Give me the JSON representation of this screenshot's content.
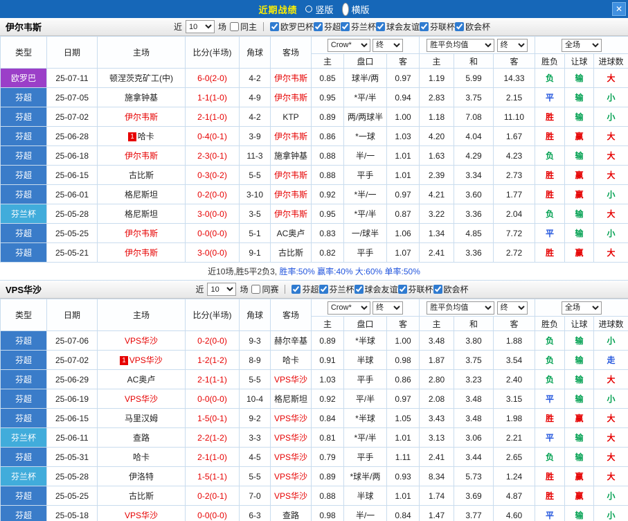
{
  "topbar": {
    "title": "近期战绩",
    "radios": [
      {
        "label": "竖版",
        "selected": false
      },
      {
        "label": "横版",
        "selected": true
      }
    ],
    "close_glyph": "✕"
  },
  "table_header": {
    "cols": [
      "类型",
      "日期",
      "主场",
      "比分(半场)",
      "角球",
      "客场"
    ],
    "odds_bookmaker": "Crow*",
    "odds_period": "终",
    "avg_label": "胜平负均值",
    "avg_period": "终",
    "scope_label": "全场",
    "sub_cols": [
      "主",
      "盘口",
      "客",
      "主",
      "和",
      "客",
      "胜负",
      "让球",
      "进球数"
    ]
  },
  "league_colors": {
    "欧罗巴": "#9B3FC8",
    "芬超": "#3A7CC9",
    "芬兰杯": "#41ACDB"
  },
  "result_colors": {
    "red": "#E60000",
    "green": "#00A050",
    "blue": "#2255DD",
    "black": "#333333"
  },
  "sections": [
    {
      "team": "伊尔韦斯",
      "filters": {
        "recent_pre": "近",
        "recent_value": "10",
        "recent_post": "场",
        "same_label": "同主",
        "same_checked": false,
        "leagues": [
          {
            "label": "欧罗巴杯",
            "checked": true
          },
          {
            "label": "芬超",
            "checked": true
          },
          {
            "label": "芬兰杯",
            "checked": true
          },
          {
            "label": "球会友谊",
            "checked": true
          },
          {
            "label": "芬联杯",
            "checked": true
          },
          {
            "label": "欧会杯",
            "checked": true
          }
        ]
      },
      "rows": [
        {
          "league": "欧罗巴",
          "date": "25-07-11",
          "home": "顿涅茨克矿工(中)",
          "home_red": false,
          "badge": "",
          "score": "6-0(2-0)",
          "corner": "4-2",
          "away": "伊尔韦斯",
          "away_red": true,
          "oh": "0.85",
          "hcp": "球半/两",
          "oa": "0.97",
          "ah": "1.19",
          "ad": "5.99",
          "aa": "14.33",
          "r1": "负",
          "c1": "green",
          "r2": "输",
          "c2": "green",
          "r3": "大",
          "c3": "red"
        },
        {
          "league": "芬超",
          "date": "25-07-05",
          "home": "施拿钟基",
          "home_red": false,
          "badge": "",
          "score": "1-1(1-0)",
          "corner": "4-9",
          "away": "伊尔韦斯",
          "away_red": true,
          "oh": "0.95",
          "hcp": "*平/半",
          "oa": "0.94",
          "ah": "2.83",
          "ad": "3.75",
          "aa": "2.15",
          "r1": "平",
          "c1": "blue",
          "r2": "输",
          "c2": "green",
          "r3": "小",
          "c3": "green"
        },
        {
          "league": "芬超",
          "date": "25-07-02",
          "home": "伊尔韦斯",
          "home_red": true,
          "badge": "",
          "score": "2-1(1-0)",
          "corner": "4-2",
          "away": "KTP",
          "away_red": false,
          "oh": "0.89",
          "hcp": "两/两球半",
          "oa": "1.00",
          "ah": "1.18",
          "ad": "7.08",
          "aa": "11.10",
          "r1": "胜",
          "c1": "red",
          "r2": "输",
          "c2": "green",
          "r3": "小",
          "c3": "green"
        },
        {
          "league": "芬超",
          "date": "25-06-28",
          "home": "哈卡",
          "home_red": false,
          "badge": "1",
          "score": "0-4(0-1)",
          "corner": "3-9",
          "away": "伊尔韦斯",
          "away_red": true,
          "oh": "0.86",
          "hcp": "*一球",
          "oa": "1.03",
          "ah": "4.20",
          "ad": "4.04",
          "aa": "1.67",
          "r1": "胜",
          "c1": "red",
          "r2": "赢",
          "c2": "red",
          "r3": "大",
          "c3": "red"
        },
        {
          "league": "芬超",
          "date": "25-06-18",
          "home": "伊尔韦斯",
          "home_red": true,
          "badge": "",
          "score": "2-3(0-1)",
          "corner": "11-3",
          "away": "施拿钟基",
          "away_red": false,
          "oh": "0.88",
          "hcp": "半/一",
          "oa": "1.01",
          "ah": "1.63",
          "ad": "4.29",
          "aa": "4.23",
          "r1": "负",
          "c1": "green",
          "r2": "输",
          "c2": "green",
          "r3": "大",
          "c3": "red"
        },
        {
          "league": "芬超",
          "date": "25-06-15",
          "home": "古比斯",
          "home_red": false,
          "badge": "",
          "score": "0-3(0-2)",
          "corner": "5-5",
          "away": "伊尔韦斯",
          "away_red": true,
          "oh": "0.88",
          "hcp": "平手",
          "oa": "1.01",
          "ah": "2.39",
          "ad": "3.34",
          "aa": "2.73",
          "r1": "胜",
          "c1": "red",
          "r2": "赢",
          "c2": "red",
          "r3": "大",
          "c3": "red"
        },
        {
          "league": "芬超",
          "date": "25-06-01",
          "home": "格尼斯坦",
          "home_red": false,
          "badge": "",
          "score": "0-2(0-0)",
          "corner": "3-10",
          "away": "伊尔韦斯",
          "away_red": true,
          "oh": "0.92",
          "hcp": "*半/一",
          "oa": "0.97",
          "ah": "4.21",
          "ad": "3.60",
          "aa": "1.77",
          "r1": "胜",
          "c1": "red",
          "r2": "赢",
          "c2": "red",
          "r3": "小",
          "c3": "green"
        },
        {
          "league": "芬兰杯",
          "date": "25-05-28",
          "home": "格尼斯坦",
          "home_red": false,
          "badge": "",
          "score": "3-0(0-0)",
          "corner": "3-5",
          "away": "伊尔韦斯",
          "away_red": true,
          "oh": "0.95",
          "hcp": "*平/半",
          "oa": "0.87",
          "ah": "3.22",
          "ad": "3.36",
          "aa": "2.04",
          "r1": "负",
          "c1": "green",
          "r2": "输",
          "c2": "green",
          "r3": "大",
          "c3": "red"
        },
        {
          "league": "芬超",
          "date": "25-05-25",
          "home": "伊尔韦斯",
          "home_red": true,
          "badge": "",
          "score": "0-0(0-0)",
          "corner": "5-1",
          "away": "AC奥卢",
          "away_red": false,
          "oh": "0.83",
          "hcp": "一/球半",
          "oa": "1.06",
          "ah": "1.34",
          "ad": "4.85",
          "aa": "7.72",
          "r1": "平",
          "c1": "blue",
          "r2": "输",
          "c2": "green",
          "r3": "小",
          "c3": "green"
        },
        {
          "league": "芬超",
          "date": "25-05-21",
          "home": "伊尔韦斯",
          "home_red": true,
          "badge": "",
          "score": "3-0(0-0)",
          "corner": "9-1",
          "away": "古比斯",
          "away_red": false,
          "oh": "0.82",
          "hcp": "平手",
          "oa": "1.07",
          "ah": "2.41",
          "ad": "3.36",
          "aa": "2.72",
          "r1": "胜",
          "c1": "red",
          "r2": "赢",
          "c2": "red",
          "r3": "大",
          "c3": "red"
        }
      ],
      "summary": [
        {
          "text": "近10场,胜5平2负3, ",
          "color": "#333333"
        },
        {
          "text": "胜率:50% ",
          "color": "#2255DD"
        },
        {
          "text": "赢率:40% ",
          "color": "#2255DD"
        },
        {
          "text": "大:60% ",
          "color": "#2255DD"
        },
        {
          "text": "单率:50%",
          "color": "#2255DD"
        }
      ]
    },
    {
      "team": "VPS华沙",
      "filters": {
        "recent_pre": "近",
        "recent_value": "10",
        "recent_post": "场",
        "same_label": "同赛",
        "same_checked": false,
        "leagues": [
          {
            "label": "芬超",
            "checked": true
          },
          {
            "label": "芬兰杯",
            "checked": true
          },
          {
            "label": "球会友谊",
            "checked": true
          },
          {
            "label": "芬联杯",
            "checked": true
          },
          {
            "label": "欧会杯",
            "checked": true
          }
        ]
      },
      "rows": [
        {
          "league": "芬超",
          "date": "25-07-06",
          "home": "VPS华沙",
          "home_red": true,
          "badge": "",
          "score": "0-2(0-0)",
          "corner": "9-3",
          "away": "赫尔辛基",
          "away_red": false,
          "oh": "0.89",
          "hcp": "*半球",
          "oa": "1.00",
          "ah": "3.48",
          "ad": "3.80",
          "aa": "1.88",
          "r1": "负",
          "c1": "green",
          "r2": "输",
          "c2": "green",
          "r3": "小",
          "c3": "green"
        },
        {
          "league": "芬超",
          "date": "25-07-02",
          "home": "VPS华沙",
          "home_red": true,
          "badge": "1",
          "score": "1-2(1-2)",
          "corner": "8-9",
          "away": "哈卡",
          "away_red": false,
          "oh": "0.91",
          "hcp": "半球",
          "oa": "0.98",
          "ah": "1.87",
          "ad": "3.75",
          "aa": "3.54",
          "r1": "负",
          "c1": "green",
          "r2": "输",
          "c2": "green",
          "r3": "走",
          "c3": "blue"
        },
        {
          "league": "芬超",
          "date": "25-06-29",
          "home": "AC奥卢",
          "home_red": false,
          "badge": "",
          "score": "2-1(1-1)",
          "corner": "5-5",
          "away": "VPS华沙",
          "away_red": true,
          "oh": "1.03",
          "hcp": "平手",
          "oa": "0.86",
          "ah": "2.80",
          "ad": "3.23",
          "aa": "2.40",
          "r1": "负",
          "c1": "green",
          "r2": "输",
          "c2": "green",
          "r3": "大",
          "c3": "red"
        },
        {
          "league": "芬超",
          "date": "25-06-19",
          "home": "VPS华沙",
          "home_red": true,
          "badge": "",
          "score": "0-0(0-0)",
          "corner": "10-4",
          "away": "格尼斯坦",
          "away_red": false,
          "oh": "0.92",
          "hcp": "平/半",
          "oa": "0.97",
          "ah": "2.08",
          "ad": "3.48",
          "aa": "3.15",
          "r1": "平",
          "c1": "blue",
          "r2": "输",
          "c2": "green",
          "r3": "小",
          "c3": "green"
        },
        {
          "league": "芬超",
          "date": "25-06-15",
          "home": "马里汉姆",
          "home_red": false,
          "badge": "",
          "score": "1-5(0-1)",
          "corner": "9-2",
          "away": "VPS华沙",
          "away_red": true,
          "oh": "0.84",
          "hcp": "*半球",
          "oa": "1.05",
          "ah": "3.43",
          "ad": "3.48",
          "aa": "1.98",
          "r1": "胜",
          "c1": "red",
          "r2": "赢",
          "c2": "red",
          "r3": "大",
          "c3": "red"
        },
        {
          "league": "芬兰杯",
          "date": "25-06-11",
          "home": "查路",
          "home_red": false,
          "badge": "",
          "score": "2-2(1-2)",
          "corner": "3-3",
          "away": "VPS华沙",
          "away_red": true,
          "oh": "0.81",
          "hcp": "*平/半",
          "oa": "1.01",
          "ah": "3.13",
          "ad": "3.06",
          "aa": "2.21",
          "r1": "平",
          "c1": "blue",
          "r2": "输",
          "c2": "green",
          "r3": "大",
          "c3": "red"
        },
        {
          "league": "芬超",
          "date": "25-05-31",
          "home": "哈卡",
          "home_red": false,
          "badge": "",
          "score": "2-1(1-0)",
          "corner": "4-5",
          "away": "VPS华沙",
          "away_red": true,
          "oh": "0.79",
          "hcp": "平手",
          "oa": "1.11",
          "ah": "2.41",
          "ad": "3.44",
          "aa": "2.65",
          "r1": "负",
          "c1": "green",
          "r2": "输",
          "c2": "green",
          "r3": "大",
          "c3": "red"
        },
        {
          "league": "芬兰杯",
          "date": "25-05-28",
          "home": "伊洛特",
          "home_red": false,
          "badge": "",
          "score": "1-5(1-1)",
          "corner": "5-5",
          "away": "VPS华沙",
          "away_red": true,
          "oh": "0.89",
          "hcp": "*球半/两",
          "oa": "0.93",
          "ah": "8.34",
          "ad": "5.73",
          "aa": "1.24",
          "r1": "胜",
          "c1": "red",
          "r2": "赢",
          "c2": "red",
          "r3": "大",
          "c3": "red"
        },
        {
          "league": "芬超",
          "date": "25-05-25",
          "home": "古比斯",
          "home_red": false,
          "badge": "",
          "score": "0-2(0-1)",
          "corner": "7-0",
          "away": "VPS华沙",
          "away_red": true,
          "oh": "0.88",
          "hcp": "半球",
          "oa": "1.01",
          "ah": "1.74",
          "ad": "3.69",
          "aa": "4.87",
          "r1": "胜",
          "c1": "red",
          "r2": "赢",
          "c2": "red",
          "r3": "小",
          "c3": "green"
        },
        {
          "league": "芬超",
          "date": "25-05-18",
          "home": "VPS华沙",
          "home_red": true,
          "badge": "",
          "score": "0-0(0-0)",
          "corner": "6-3",
          "away": "查路",
          "away_red": false,
          "oh": "0.98",
          "hcp": "半/一",
          "oa": "0.84",
          "ah": "1.47",
          "ad": "3.77",
          "aa": "4.60",
          "r1": "平",
          "c1": "blue",
          "r2": "输",
          "c2": "green",
          "r3": "小",
          "c3": "green"
        }
      ],
      "summary": []
    }
  ]
}
